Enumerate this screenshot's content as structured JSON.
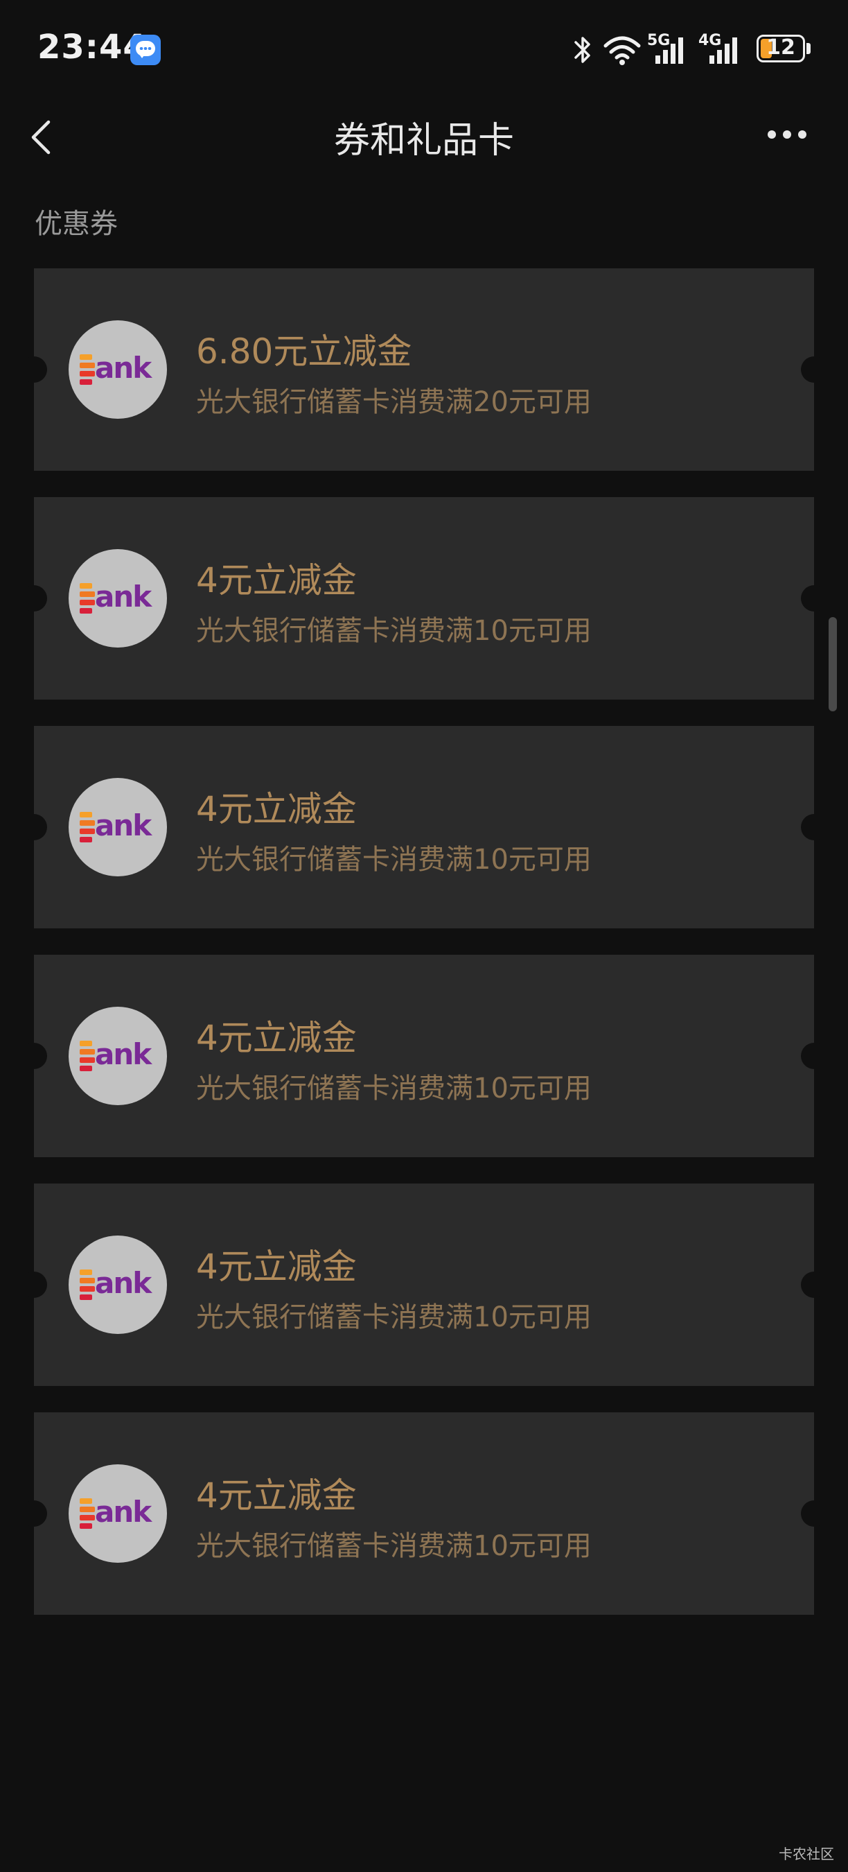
{
  "status_bar": {
    "time": "23:44",
    "network_1": "5G",
    "network_2": "4G",
    "battery": "12"
  },
  "nav": {
    "title": "券和礼品卡"
  },
  "section": {
    "title": "优惠券"
  },
  "logo_text": "ank",
  "coupons": [
    {
      "amount": "6.80元立减金",
      "desc": "光大银行储蓄卡消费满20元可用"
    },
    {
      "amount": "4元立减金",
      "desc": "光大银行储蓄卡消费满10元可用"
    },
    {
      "amount": "4元立减金",
      "desc": "光大银行储蓄卡消费满10元可用"
    },
    {
      "amount": "4元立减金",
      "desc": "光大银行储蓄卡消费满10元可用"
    },
    {
      "amount": "4元立减金",
      "desc": "光大银行储蓄卡消费满10元可用"
    },
    {
      "amount": "4元立减金",
      "desc": "光大银行储蓄卡消费满10元可用"
    }
  ],
  "watermark": "卡农社区",
  "colors": {
    "background": "#101010",
    "card": "#2b2b2b",
    "amount_gold": "#b08a5a",
    "desc_gold": "#8e7453",
    "battery_level": "#f5a02a"
  }
}
